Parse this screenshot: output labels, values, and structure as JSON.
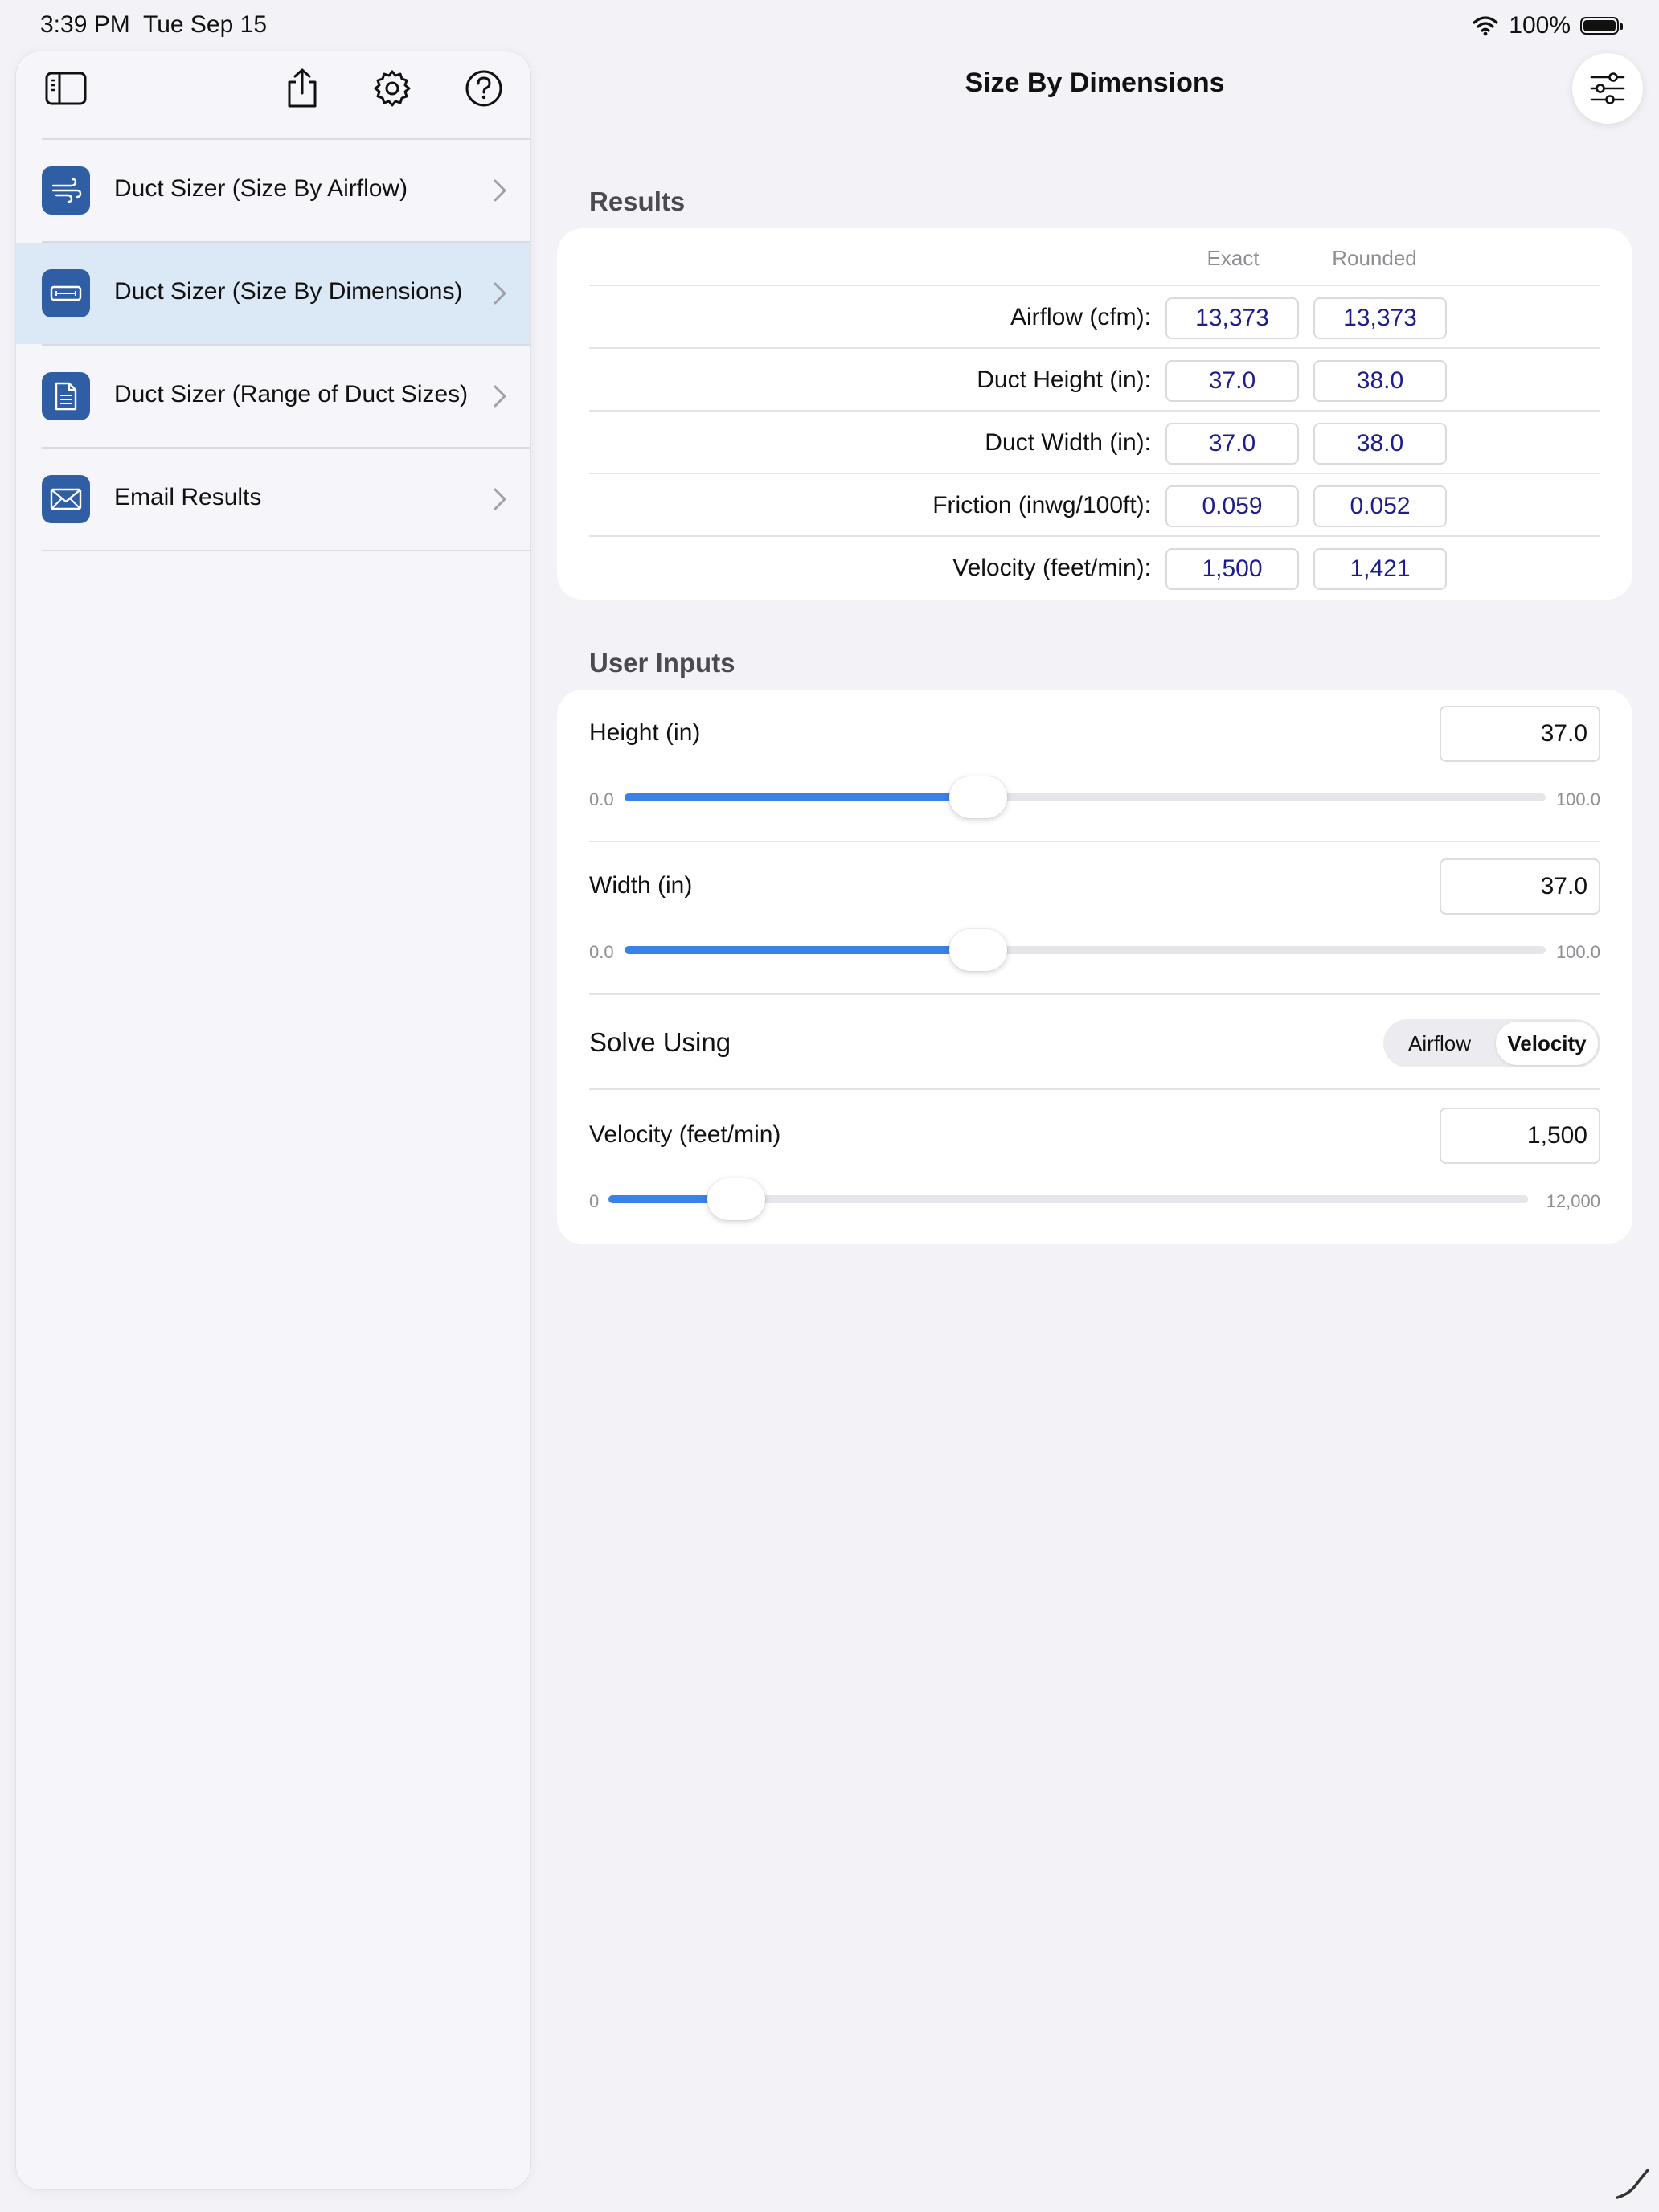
{
  "status_bar": {
    "time": "3:39 PM",
    "date": "Tue Sep 15",
    "battery": "100%"
  },
  "sidebar": {
    "toolbar_icons": [
      "sidebar-toggle-icon",
      "share-icon",
      "gear-icon",
      "help-icon"
    ],
    "items": [
      {
        "label": "Duct Sizer (Size By Airflow)",
        "icon": "wind-icon",
        "selected": false
      },
      {
        "label": "Duct Sizer (Size By Dimensions)",
        "icon": "duct-icon",
        "selected": true
      },
      {
        "label": "Duct Sizer (Range of Duct Sizes)",
        "icon": "document-icon",
        "selected": false
      },
      {
        "label": "Email Results",
        "icon": "envelope-icon",
        "selected": false
      }
    ]
  },
  "main": {
    "title": "Size By Dimensions",
    "results": {
      "section_title": "Results",
      "col_exact": "Exact",
      "col_rounded": "Rounded",
      "rows": [
        {
          "label": "Airflow (cfm):",
          "exact": "13,373",
          "rounded": "13,373"
        },
        {
          "label": "Duct Height (in):",
          "exact": "37.0",
          "rounded": "38.0"
        },
        {
          "label": "Duct Width (in):",
          "exact": "37.0",
          "rounded": "38.0"
        },
        {
          "label": "Friction (inwg/100ft):",
          "exact": "0.059",
          "rounded": "0.052"
        },
        {
          "label": "Velocity (feet/min):",
          "exact": "1,500",
          "rounded": "1,421"
        }
      ]
    },
    "inputs": {
      "section_title": "User Inputs",
      "height": {
        "label": "Height (in)",
        "value": "37.0",
        "min_label": "0.0",
        "max_label": "100.0",
        "fraction": 0.37
      },
      "width": {
        "label": "Width (in)",
        "value": "37.0",
        "min_label": "0.0",
        "max_label": "100.0",
        "fraction": 0.37
      },
      "solve_using": {
        "label": "Solve Using",
        "options": [
          "Airflow",
          "Velocity"
        ],
        "selected": "Velocity"
      },
      "velocity": {
        "label": "Velocity (feet/min)",
        "value": "1,500",
        "min_label": "0",
        "max_label": "12,000",
        "fraction": 0.125
      }
    }
  },
  "colors": {
    "accent": "#3b82e8",
    "icon_bg": "#2f5ea4",
    "selected_row": "#dbe8f6",
    "value_text": "#1d1d8f"
  }
}
